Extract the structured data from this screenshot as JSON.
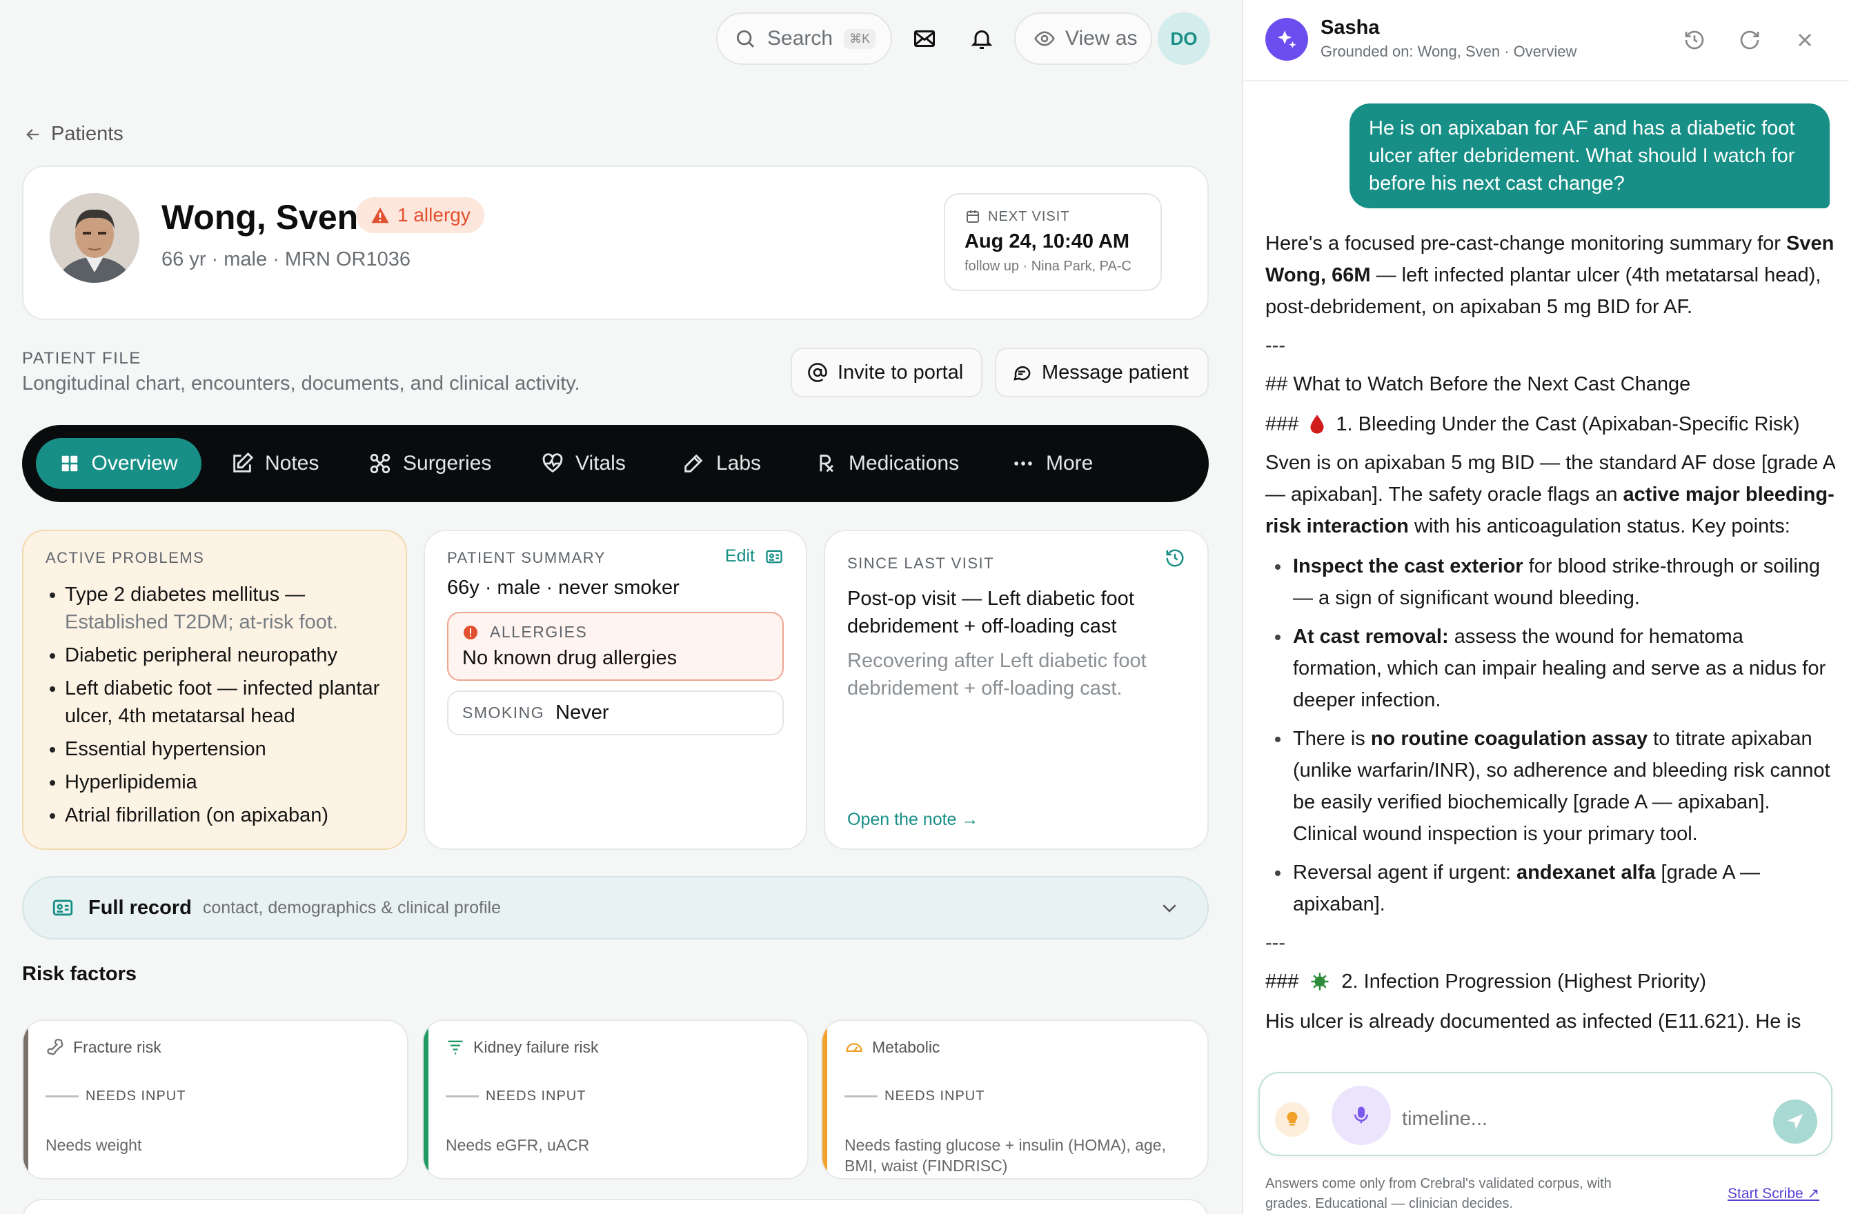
{
  "topbar": {
    "search_label": "Search",
    "search_shortcut": "⌘K",
    "view_as_label": "View as",
    "user_initials": "DO"
  },
  "breadcrumb": {
    "back_label": "Patients"
  },
  "patient": {
    "name": "Wong, Sven",
    "allergy_badge": "1 allergy",
    "meta": "66 yr · male · MRN OR1036",
    "next_visit_label": "NEXT VISIT",
    "next_visit_date": "Aug 24, 10:40 AM",
    "next_visit_detail": "follow up · Nina Park, PA-C"
  },
  "patient_file": {
    "title": "PATIENT FILE",
    "subtitle": "Longitudinal chart, encounters, documents, and clinical activity.",
    "invite_label": "Invite to portal",
    "message_label": "Message patient"
  },
  "tabs": [
    {
      "label": "Overview",
      "icon": "grid-icon",
      "active": true
    },
    {
      "label": "Notes",
      "icon": "edit-icon"
    },
    {
      "label": "Surgeries",
      "icon": "scissors-icon"
    },
    {
      "label": "Vitals",
      "icon": "heart-pulse-icon"
    },
    {
      "label": "Labs",
      "icon": "pipette-icon"
    },
    {
      "label": "Medications",
      "icon": "rx-icon"
    },
    {
      "label": "More",
      "icon": "ellipsis-icon"
    }
  ],
  "active_problems": {
    "title": "ACTIVE PROBLEMS",
    "items": [
      {
        "text": "Type 2 diabetes mellitus —",
        "sub": "Established T2DM; at-risk foot."
      },
      {
        "text": "Diabetic peripheral neuropathy"
      },
      {
        "text": "Left diabetic foot — infected plantar ulcer, 4th metatarsal head"
      },
      {
        "text": "Essential hypertension"
      },
      {
        "text": "Hyperlipidemia"
      },
      {
        "text": "Atrial fibrillation (on apixaban)"
      }
    ]
  },
  "summary": {
    "title": "PATIENT SUMMARY",
    "edit_label": "Edit",
    "line": "66y · male · never smoker",
    "allergies_label": "ALLERGIES",
    "allergies_value": "No known drug allergies",
    "smoking_label": "SMOKING",
    "smoking_value": "Never"
  },
  "since_last": {
    "title": "SINCE LAST VISIT",
    "headline": "Post-op visit — Left diabetic foot debridement + off-loading cast",
    "body": "Recovering after Left diabetic foot debridement + off-loading cast.",
    "link": "Open the note →"
  },
  "full_record": {
    "title": "Full record",
    "subtitle": "contact, demographics & clinical profile"
  },
  "risk_factors": {
    "title": "Risk factors",
    "cards": [
      {
        "name": "Fracture risk",
        "status": "NEEDS INPUT",
        "desc": "Needs weight",
        "color": "#7a7068"
      },
      {
        "name": "Kidney failure risk",
        "status": "NEEDS INPUT",
        "desc": "Needs eGFR, uACR",
        "color": "#1f9a63"
      },
      {
        "name": "Metabolic",
        "status": "NEEDS INPUT",
        "desc": "Needs fasting glucose + insulin (HOMA), age, BMI, waist (FINDRISC)",
        "color": "#f0a22a"
      }
    ]
  },
  "chat": {
    "assistant_name": "Sasha",
    "grounded": "Grounded on: Wong, Sven · Overview",
    "user_message": "He is on apixaban for AF and has a diabetic foot ulcer after debridement. What should I watch for before his next cast change?",
    "intro_a": "Here's a focused pre-cast-change monitoring summary for ",
    "intro_b": "Sven Wong, 66M",
    "intro_c": " — left infected plantar ulcer (4th metatarsal head), post-debridement, on apixaban 5 mg BID for AF.",
    "sep": "---",
    "h2": "## What to Watch Before the Next Cast Change",
    "h3a_prefix": "###",
    "h3a": "1. Bleeding Under the Cast (Apixaban-Specific Risk)",
    "p1_a": "Sven is on apixaban 5 mg BID — the standard AF dose [grade A — apixaban]. The safety oracle flags an ",
    "p1_b": "active major bleeding-risk interaction",
    "p1_c": " with his anticoagulation status. Key points:",
    "b1_a": "Inspect the cast exterior",
    "b1_b": " for blood strike-through or soiling — a sign of significant wound bleeding.",
    "b2_a": "At cast removal:",
    "b2_b": " assess the wound for hematoma formation, which can impair healing and serve as a nidus for deeper infection.",
    "b3_a": "There is ",
    "b3_b": "no routine coagulation assay",
    "b3_c": " to titrate apixaban (unlike warfarin/INR), so adherence and bleeding risk cannot be easily verified biochemically [grade A — apixaban]. Clinical wound inspection is your primary tool.",
    "b4_a": "Reversal agent if urgent: ",
    "b4_b": "andexanet alfa",
    "b4_c": " [grade A — apixaban].",
    "sep2": "---",
    "h3b_prefix": "###",
    "h3b": "2. Infection Progression (Highest Priority)",
    "cut_line": "His ulcer is already documented as infected (E11.621). He is",
    "input_placeholder": "timeline...",
    "footer": "Answers come only from Crebral's validated corpus, with grades. Educational — clinician decides.",
    "start_scribe": "Start Scribe ↗"
  },
  "colors": {
    "teal": "#178f86",
    "dark_nav": "#0a0b0c",
    "alert": "#e2512f"
  }
}
